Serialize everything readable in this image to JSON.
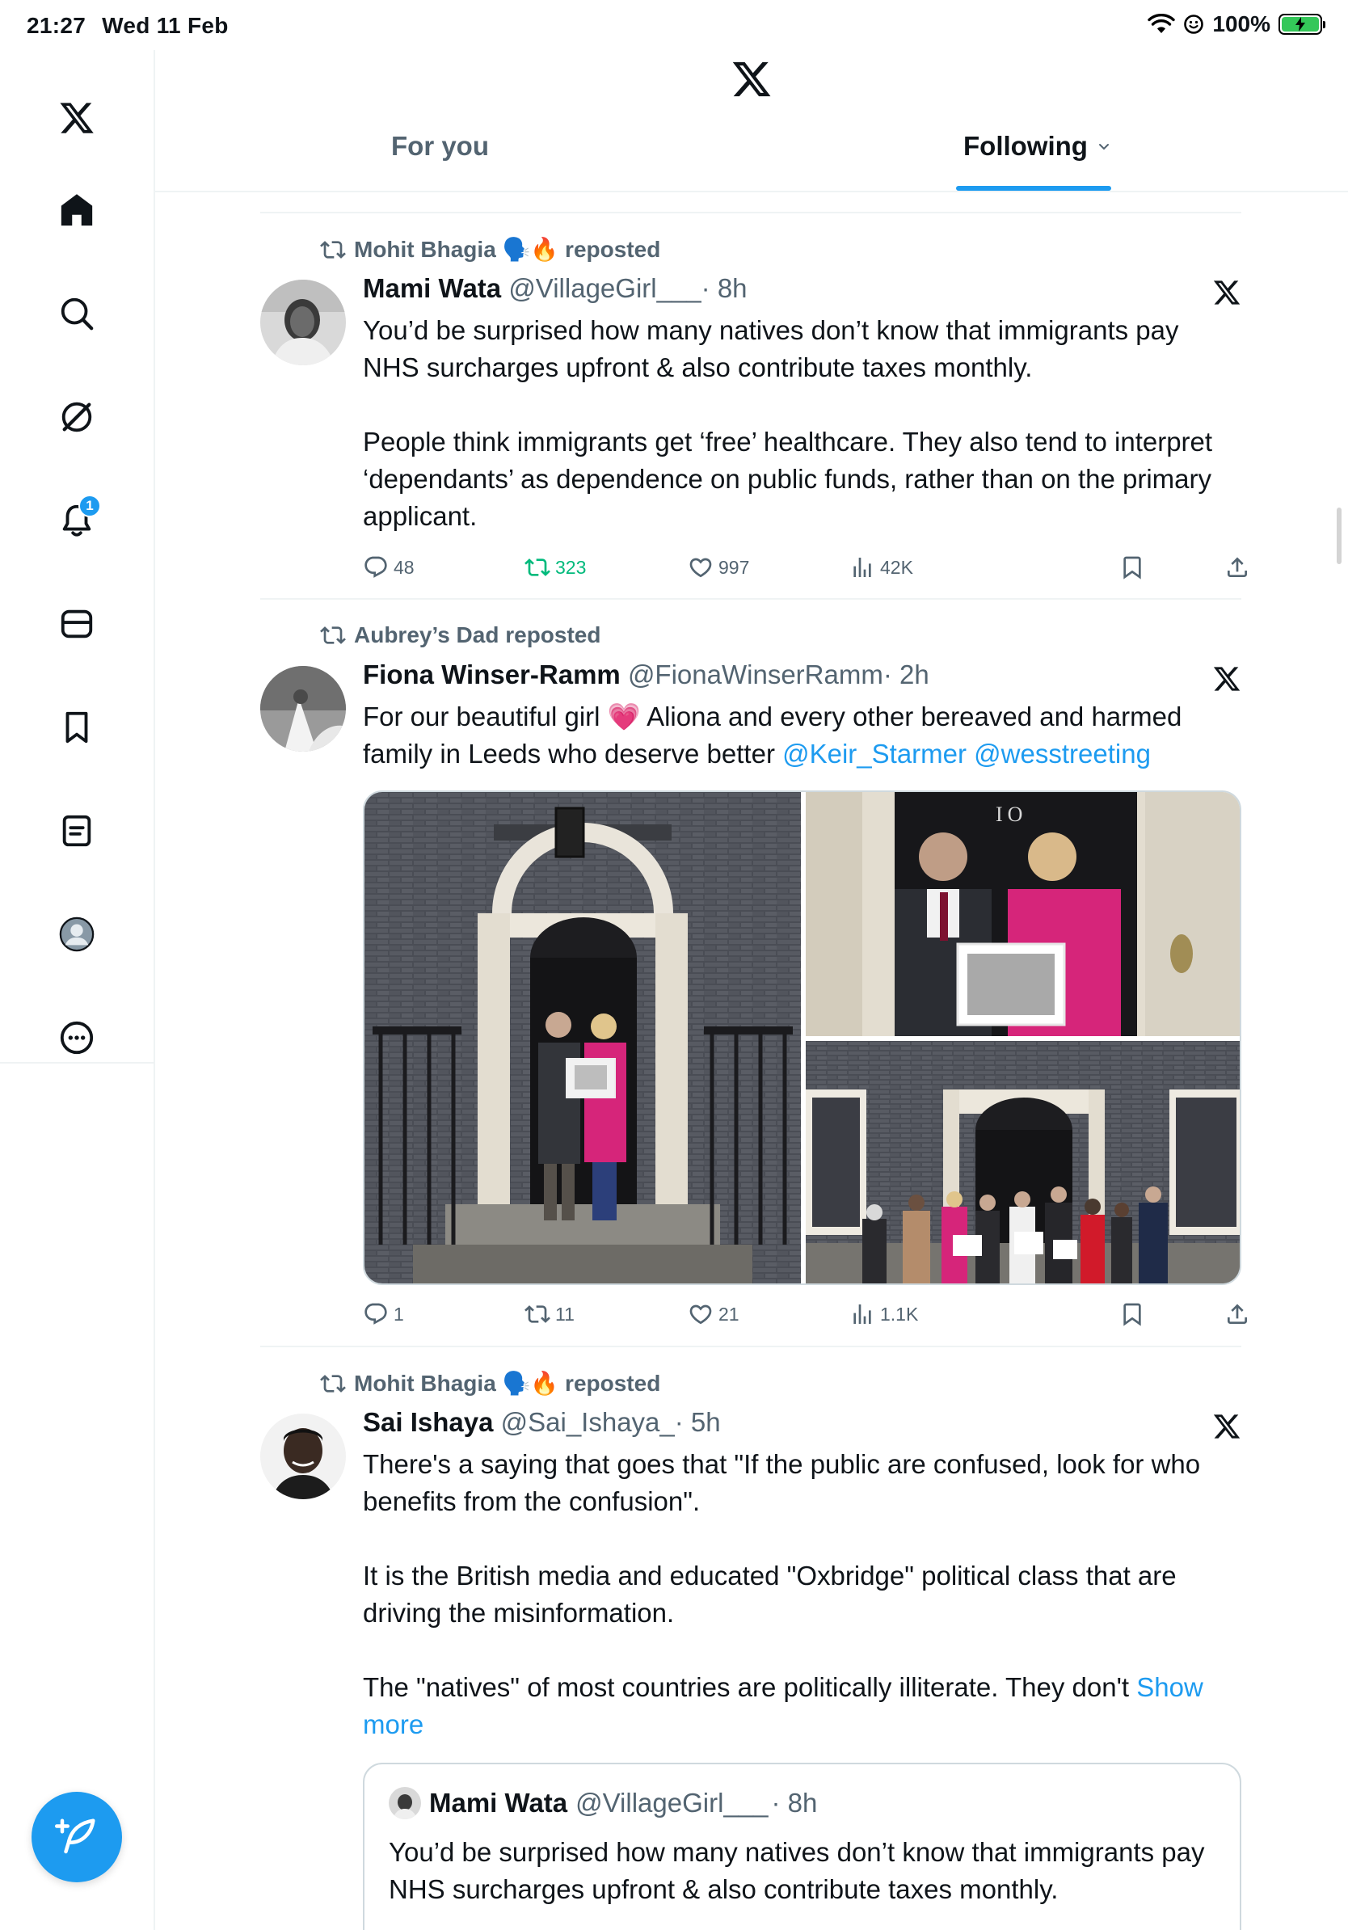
{
  "status_bar": {
    "time": "21:27",
    "date": "Wed 11 Feb",
    "battery": "100%"
  },
  "sidebar": {
    "items": [
      {
        "name": "home"
      },
      {
        "name": "explore"
      },
      {
        "name": "grok"
      },
      {
        "name": "notifications",
        "badge": "1"
      },
      {
        "name": "messages"
      },
      {
        "name": "bookmarks"
      },
      {
        "name": "lists"
      },
      {
        "name": "profile"
      },
      {
        "name": "more"
      }
    ]
  },
  "header": {
    "tabs": [
      {
        "label": "For you",
        "selected": false
      },
      {
        "label": "Following",
        "selected": true
      }
    ]
  },
  "posts": [
    {
      "repost_by": "Mohit Bhagia 🗣️🔥 reposted",
      "name": "Mami Wata",
      "handle": "@VillageGirl___",
      "time": "· 8h",
      "paragraphs": [
        "You’d be surprised how many natives don’t know that immigrants pay NHS surcharges upfront & also contribute taxes monthly.",
        "People think immigrants get ‘free’ healthcare. They also tend to interpret ‘dependants’ as dependence on public funds, rather than on the primary applicant."
      ],
      "stats": {
        "replies": "48",
        "reposts": "323",
        "likes": "997",
        "views": "42K"
      }
    },
    {
      "repost_by": "Aubrey’s Dad reposted",
      "name": "Fiona Winser-Ramm",
      "handle": "@FionaWinserRamm",
      "time": "· 2h",
      "text_before": "For our beautiful girl 💗 Aliona and every other bereaved and harmed family in Leeds who deserve better ",
      "mention1": "@Keir_Starmer",
      "mention2": "@wesstreeting",
      "stats": {
        "replies": "1",
        "reposts": "11",
        "likes": "21",
        "views": "1.1K"
      }
    },
    {
      "repost_by": "Mohit Bhagia 🗣️🔥 reposted",
      "name": "Sai Ishaya",
      "handle": "@Sai_Ishaya_",
      "time": "· 5h",
      "paragraphs": [
        "There's a saying that goes that \"If the public are confused, look for who benefits from the confusion\".",
        "It is the British media and educated \"Oxbridge\" political class that are driving the misinformation."
      ],
      "last_paragraph": "The \"natives\" of most countries are politically illiterate. They don't ",
      "show_more": "Show more",
      "quote": {
        "name": "Mami Wata",
        "handle": "@VillageGirl___",
        "time": "· 8h",
        "text": "You’d be surprised how many natives don’t know that immigrants pay NHS surcharges upfront & also contribute taxes monthly."
      }
    }
  ]
}
